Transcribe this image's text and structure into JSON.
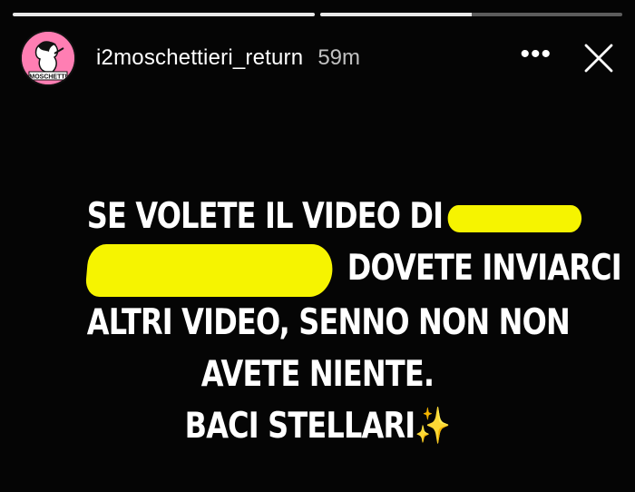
{
  "progress": [
    {
      "fraction": 1.0
    },
    {
      "fraction": 0.5
    }
  ],
  "header": {
    "avatar_label": "MOSCHETTI",
    "username": "i2moschettieri_return",
    "time": "59m",
    "more_icon": "•••",
    "close_icon": "close-icon"
  },
  "story": {
    "line1": "SE VOLETE IL VIDEO DI",
    "line2_end": "DOVETE INVIARCI",
    "line3": "ALTRI VIDEO, SENNO NON NON",
    "line4": "AVETE NIENTE.",
    "line5": "BACI STELLARI",
    "sparkles": "✨",
    "redaction_color": "#f6f400"
  }
}
